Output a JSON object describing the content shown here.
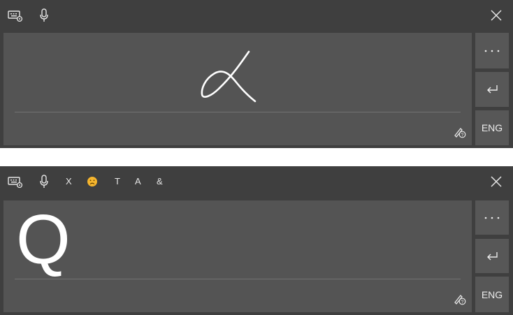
{
  "colors": {
    "panel_bg": "#3f3f3f",
    "canvas_bg": "#545454",
    "side_button_bg": "#575757",
    "ink": "#ffffff",
    "emoji_accent": "#f5b52e"
  },
  "top_panel": {
    "toolbar": {
      "keyboard_settings_icon": "keyboard-settings-icon",
      "microphone_icon": "microphone-icon",
      "close_icon": "close-icon"
    },
    "canvas": {
      "handwriting_stroke": "alpha-like-handwritten-stroke",
      "help_icon": "handwriting-help-icon"
    },
    "side_buttons": {
      "more_icon": "more-dots-icon",
      "enter_icon": "enter-icon",
      "language_label": "ENG"
    }
  },
  "bottom_panel": {
    "toolbar": {
      "keyboard_settings_icon": "keyboard-settings-icon",
      "microphone_icon": "microphone-icon",
      "suggestions": [
        "X",
        "T",
        "A",
        "&"
      ],
      "emoji_icon": "frown-emoji-icon",
      "close_icon": "close-icon"
    },
    "canvas": {
      "recognized_text": "Q",
      "help_icon": "handwriting-help-icon"
    },
    "side_buttons": {
      "more_icon": "more-dots-icon",
      "enter_icon": "enter-icon",
      "language_label": "ENG"
    }
  }
}
